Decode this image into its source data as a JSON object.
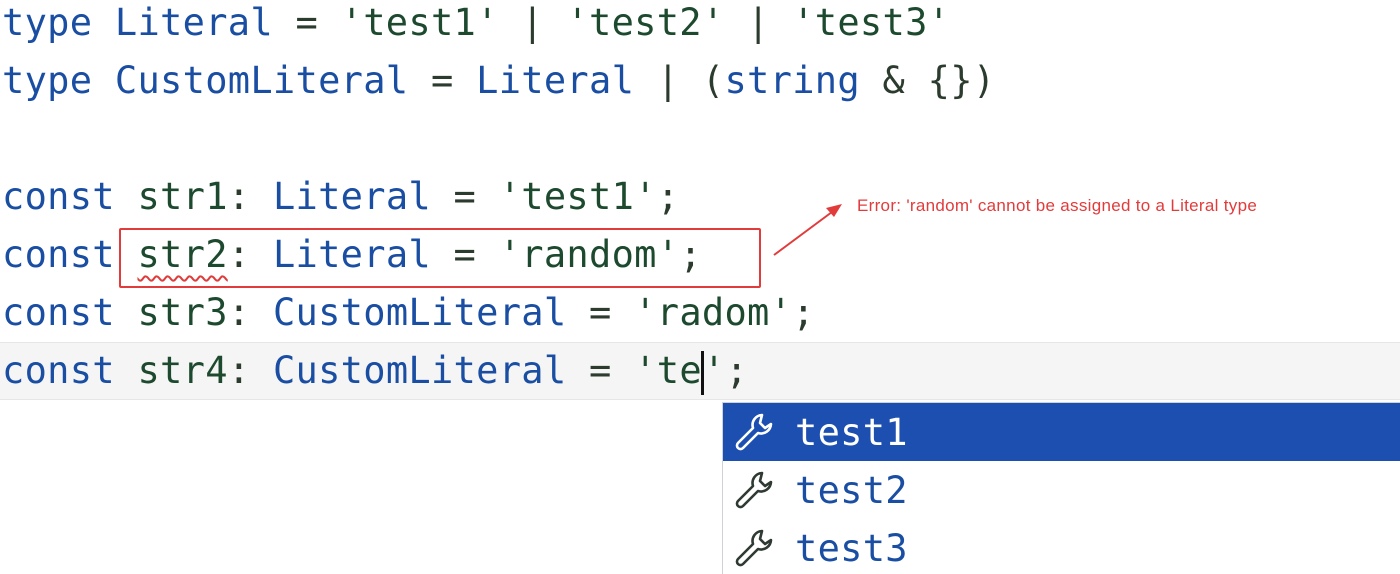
{
  "code": {
    "line1": {
      "kw": "type",
      "name": "Literal",
      "eq": "=",
      "v1": "'test1'",
      "pipe1": "|",
      "v2": "'test2'",
      "pipe2": "|",
      "v3": "'test3'"
    },
    "line2": {
      "kw": "type",
      "name": "CustomLiteral",
      "eq": "=",
      "ref": "Literal",
      "pipe": "|",
      "paren_open": "(",
      "string_kw": "string",
      "amp": "&",
      "obj": "{}",
      "paren_close": ")"
    },
    "line4": {
      "kw": "const",
      "name": "str1",
      "colon": ":",
      "type": "Literal",
      "eq": "=",
      "value": "'test1'",
      "semi": ";"
    },
    "line5": {
      "kw": "const",
      "name": "str2",
      "colon": ":",
      "type": "Literal",
      "eq": "=",
      "value": "'random'",
      "semi": ";"
    },
    "line6": {
      "kw": "const",
      "name": "str3",
      "colon": ":",
      "type": "CustomLiteral",
      "eq": "=",
      "value": "'radom'",
      "semi": ";"
    },
    "line7": {
      "kw": "const",
      "name": "str4",
      "colon": ":",
      "type": "CustomLiteral",
      "eq": "=",
      "value_before_caret": "'te",
      "value_after_caret": "'",
      "semi": ";"
    }
  },
  "annotation": {
    "error_text": "Error: 'random' cannot be assigned to a Literal type",
    "color": "#e23b3b"
  },
  "autocomplete": {
    "items": [
      {
        "label": "test1",
        "icon": "wrench-icon",
        "selected": true
      },
      {
        "label": "test2",
        "icon": "wrench-icon",
        "selected": false
      },
      {
        "label": "test3",
        "icon": "wrench-icon",
        "selected": false
      }
    ],
    "selected_color": "#1d4fb0"
  },
  "colors": {
    "keyword": "#1a4ea3",
    "identifier": "#1d4a2e",
    "error": "#e23b3b"
  }
}
